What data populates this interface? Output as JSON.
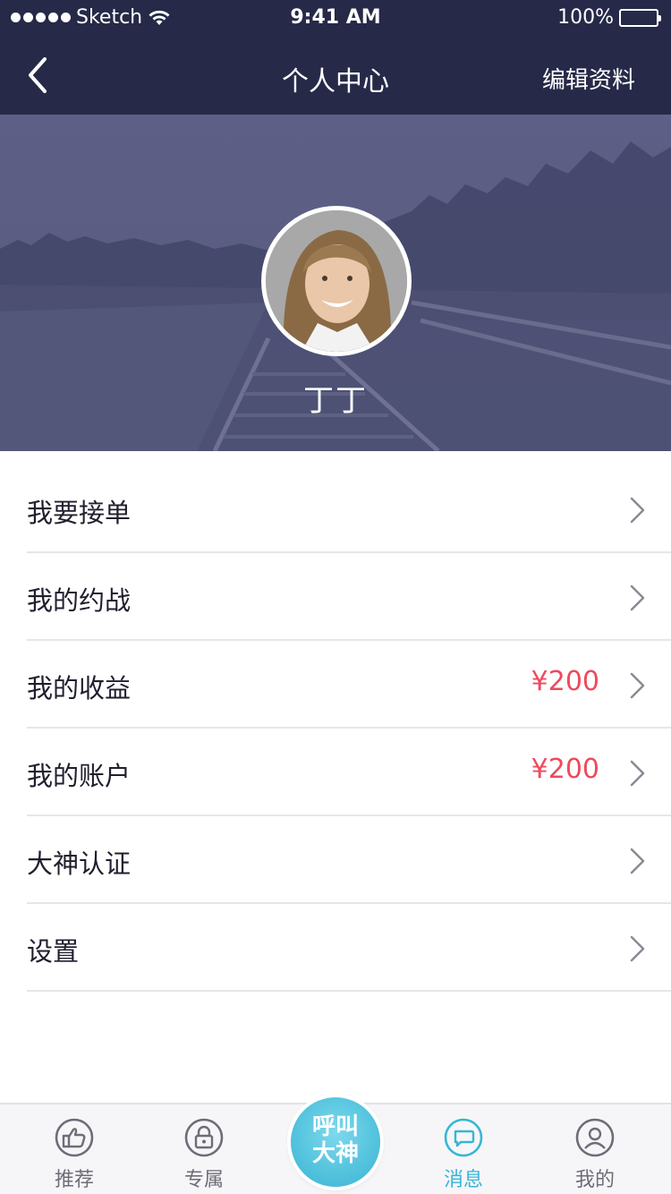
{
  "status_bar": {
    "carrier": "Sketch",
    "time": "9:41 AM",
    "battery": "100%"
  },
  "nav": {
    "title": "个人中心",
    "edit_label": "编辑资料"
  },
  "profile": {
    "name": "丁丁"
  },
  "menu": {
    "items": [
      {
        "label": "我要接单",
        "value": ""
      },
      {
        "label": "我的约战",
        "value": ""
      },
      {
        "label": "我的收益",
        "value": "¥200"
      },
      {
        "label": "我的账户",
        "value": "¥200"
      },
      {
        "label": "大神认证",
        "value": ""
      },
      {
        "label": "设置",
        "value": ""
      }
    ]
  },
  "tab_bar": {
    "tabs": [
      {
        "label": "推荐",
        "icon": "thumbs-up-icon"
      },
      {
        "label": "专属",
        "icon": "lock-icon"
      },
      {
        "label": "消息",
        "icon": "message-icon",
        "active": true
      },
      {
        "label": "我的",
        "icon": "user-icon"
      }
    ],
    "center_line1": "呼叫",
    "center_line2": "大神"
  },
  "colors": {
    "header_bg": "#262948",
    "accent": "#36b6d6",
    "price": "#ee4a5d"
  }
}
